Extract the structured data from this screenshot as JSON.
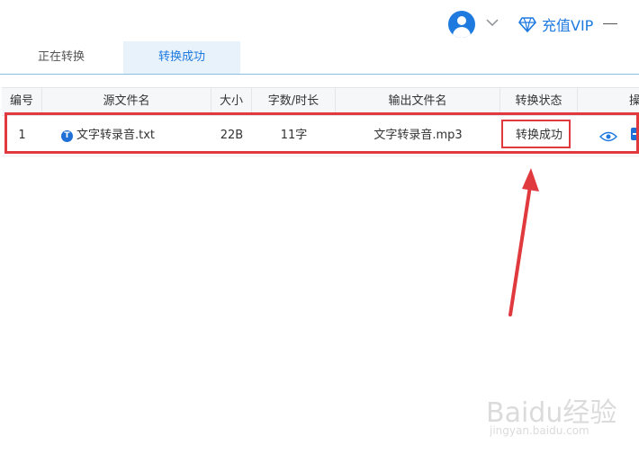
{
  "header": {
    "vip_label": "充值VIP"
  },
  "tabs": [
    {
      "label": "正在转换",
      "active": false
    },
    {
      "label": "转换成功",
      "active": true
    }
  ],
  "table": {
    "columns": [
      "编号",
      "源文件名",
      "大小",
      "字数/时长",
      "输出文件名",
      "转换状态",
      "操"
    ],
    "rows": [
      {
        "no": "1",
        "file_icon_letter": "T",
        "source": "文字转录音.txt",
        "size": "22B",
        "count": "11字",
        "output": "文字转录音.mp3",
        "status": "转换成功"
      }
    ]
  },
  "watermark": {
    "brand": "Baidu经验",
    "url": "jingyan.baidu.com"
  },
  "colors": {
    "accent": "#1f7ae0",
    "highlight": "#e0393e"
  }
}
